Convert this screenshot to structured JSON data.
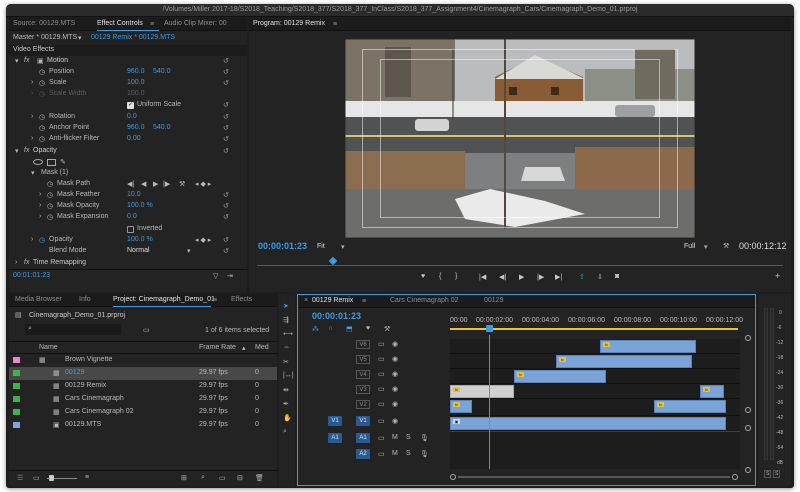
{
  "window": {
    "path": "/Volumes/Miller 2017-18/S2018_Teaching/S2018_377/S2018_377_InClass/S2018_377_Assignment4/Cinemagraph_Cars/Cinemagraph_Demo_01.prproj"
  },
  "left_panel": {
    "tabs": [
      "Source: 00129.MTS",
      "Effect Controls",
      "Audio Clip Mixer: 00"
    ],
    "master": "Master * 00129.MTS",
    "clip_ref": "00129 Remix * 00129.MTS",
    "section": "Video Effects",
    "motion": {
      "label": "Motion",
      "position": {
        "label": "Position",
        "x": "960.0",
        "y": "540.0"
      },
      "scale": {
        "label": "Scale",
        "value": "100.0"
      },
      "scale_width": {
        "label": "Scale Width",
        "value": "100.0"
      },
      "uniform_scale": "Uniform Scale",
      "rotation": {
        "label": "Rotation",
        "value": "0.0"
      },
      "anchor": {
        "label": "Anchor Point",
        "x": "960.0",
        "y": "540.0"
      },
      "flicker": {
        "label": "Anti-flicker Filter",
        "value": "0.00"
      }
    },
    "opacity": {
      "label": "Opacity",
      "mask": "Mask (1)",
      "mask_path": "Mask Path",
      "mask_feather": {
        "label": "Mask Feather",
        "value": "10.0"
      },
      "mask_opacity": {
        "label": "Mask Opacity",
        "value": "100.0 %"
      },
      "mask_expansion": {
        "label": "Mask Expansion",
        "value": "0.0"
      },
      "inverted": "Inverted",
      "opacity_prop": {
        "label": "Opacity",
        "value": "100.0 %"
      },
      "blend_label": "Blend Mode",
      "blend_value": "Normal"
    },
    "time_remapping": "Time Remapping",
    "timecode": "00:01:01:23"
  },
  "program": {
    "tab": "Program: 00129 Remix",
    "timecode": "00:00:01:23",
    "fit": "Fit",
    "full": "Full",
    "duration": "00:00:12:12"
  },
  "project": {
    "tabs": [
      "Media Browser",
      "Info",
      "Project: Cinemagraph_Demo_01",
      "Effects"
    ],
    "file": "Cinemagraph_Demo_01.prproj",
    "count": "1 of 6 items selected",
    "col_name": "Name",
    "col_rate": "Frame Rate",
    "col_med": "Med",
    "items": [
      {
        "name": "Brown Vignette",
        "rate": "",
        "color": "#e986d6"
      },
      {
        "name": "00129",
        "rate": "29.97 fps",
        "color": "#3bb54a"
      },
      {
        "name": "00129 Remix",
        "rate": "29.97 fps",
        "color": "#3bb54a"
      },
      {
        "name": "Cars Cinemagraph",
        "rate": "29.97 fps",
        "color": "#3bb54a"
      },
      {
        "name": "Cars Cinemagraph 02",
        "rate": "29.97 fps",
        "color": "#3bb54a"
      },
      {
        "name": "00129.MTS",
        "rate": "29.97 fps",
        "color": "#7da6dd"
      }
    ]
  },
  "timeline": {
    "tabs": [
      "00129 Remix",
      "Cars Cinemagraph 02",
      "00129"
    ],
    "timecode": "00:00:01:23",
    "ruler": [
      "00:00",
      "00:00:02:00",
      "00:00:04:00",
      "00:00:06:00",
      "00:00:08:00",
      "00:00:10:00",
      "00:00:12:00"
    ],
    "video_tracks": [
      "V6",
      "V5",
      "V4",
      "V3",
      "V2",
      "V1"
    ],
    "audio_tracks": [
      "A1",
      "A2"
    ],
    "src_v": "V1",
    "src_a": "A1",
    "meter_labels": [
      "0",
      "-6",
      "-12",
      "-18",
      "-24",
      "-30",
      "-36",
      "-42",
      "-48",
      "-54",
      "dB"
    ]
  },
  "colors": {
    "accent": "#3a9be6",
    "clip": "#7aa4d8",
    "bg": "#232323"
  }
}
